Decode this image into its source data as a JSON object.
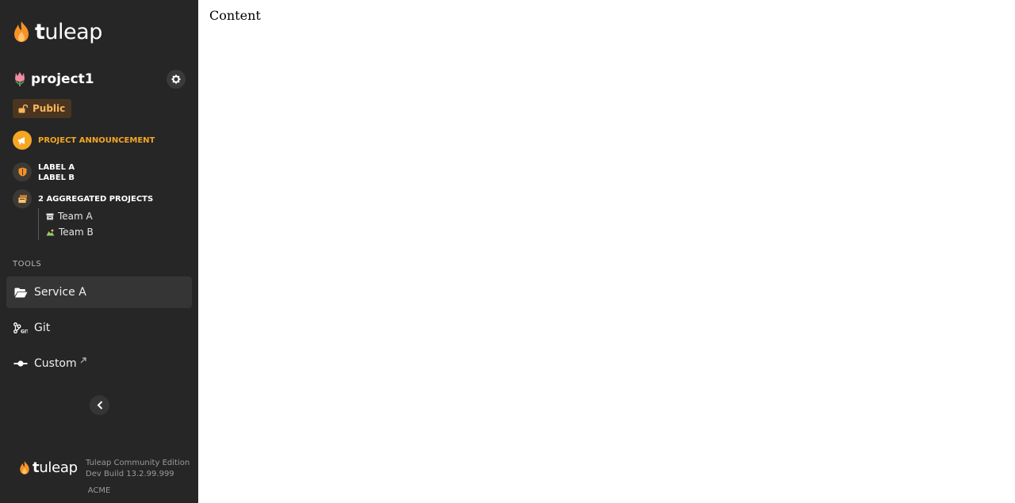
{
  "brand": {
    "logo_text_bold": "t",
    "logo_text_rest": "uleap",
    "accent": "#f79226"
  },
  "project": {
    "name": "project1",
    "visibility": "Public",
    "announcement": "PROJECT ANNOUNCEMENT",
    "labels": [
      "LABEL A",
      "LABEL B"
    ],
    "aggregated": {
      "title": "2 AGGREGATED PROJECTS",
      "teams": [
        "Team A",
        "Team B"
      ]
    }
  },
  "tools": {
    "heading": "TOOLS",
    "items": [
      {
        "label": "Service A",
        "icon": "folder-open-icon",
        "active": true
      },
      {
        "label": "Git",
        "icon": "git-icon",
        "active": false
      },
      {
        "label": "Custom",
        "icon": "plugin-icon",
        "active": false,
        "external": true
      }
    ]
  },
  "footer": {
    "logo_bold": "t",
    "logo_rest": "uleap",
    "edition": "Tuleap Community Edition",
    "build": "Dev Build 13.2.99.999",
    "org": "ACME"
  },
  "main": {
    "content": "Content"
  }
}
